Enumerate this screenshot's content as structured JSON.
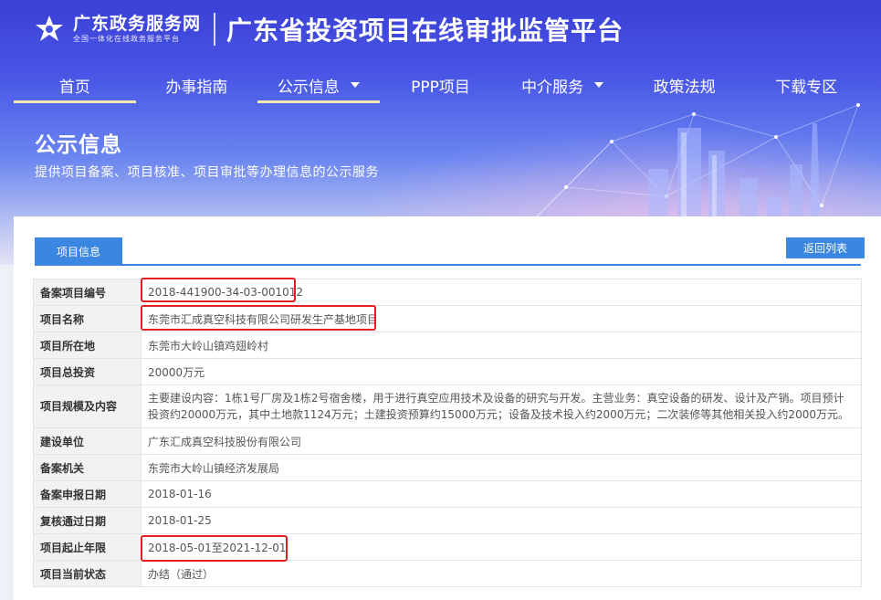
{
  "brand": {
    "name": "广东政务服务网",
    "tagline": "全国一体化在线政务服务平台",
    "platform_title": "广东省投资项目在线审批监管平台"
  },
  "nav": [
    {
      "label": "首页",
      "active": true,
      "dropdown": false
    },
    {
      "label": "办事指南",
      "active": false,
      "dropdown": false
    },
    {
      "label": "公示信息",
      "active": true,
      "dropdown": true
    },
    {
      "label": "PPP项目",
      "active": false,
      "dropdown": false
    },
    {
      "label": "中介服务",
      "active": false,
      "dropdown": true
    },
    {
      "label": "政策法规",
      "active": false,
      "dropdown": false
    },
    {
      "label": "下载专区",
      "active": false,
      "dropdown": false
    }
  ],
  "banner": {
    "title": "公示信息",
    "subtitle": "提供项目备案、项目核准、项目审批等办理信息的公示服务"
  },
  "tabs": {
    "project_info": "项目信息",
    "back_to_list": "返回列表"
  },
  "rows": [
    {
      "key": "备案项目编号",
      "value": "2018-441900-34-03-001012"
    },
    {
      "key": "项目名称",
      "value": "东莞市汇成真空科技有限公司研发生产基地项目"
    },
    {
      "key": "项目所在地",
      "value": "东莞市大岭山镇鸡翅岭村"
    },
    {
      "key": "项目总投资",
      "value": "20000万元"
    },
    {
      "key": "项目规模及内容",
      "value": "主要建设内容：1栋1号厂房及1栋2号宿舍楼，用于进行真空应用技术及设备的研究与开发。主营业务：真空设备的研发、设计及产销。项目预计投资约20000万元，其中土地款1124万元；土建投资预算约15000万元；设备及技术投入约2000万元；二次装修等其他相关投入约2000万元。"
    },
    {
      "key": "建设单位",
      "value": "广东汇成真空科技股份有限公司"
    },
    {
      "key": "备案机关",
      "value": "东莞市大岭山镇经济发展局"
    },
    {
      "key": "备案申报日期",
      "value": "2018-01-16"
    },
    {
      "key": "复核通过日期",
      "value": "2018-01-25"
    },
    {
      "key": "项目起止年限",
      "value": "2018-05-01至2021-12-01"
    },
    {
      "key": "项目当前状态",
      "value": "办结（通过）"
    }
  ],
  "colors": {
    "accent": "#3a86e0",
    "highlight": "#e02020"
  }
}
